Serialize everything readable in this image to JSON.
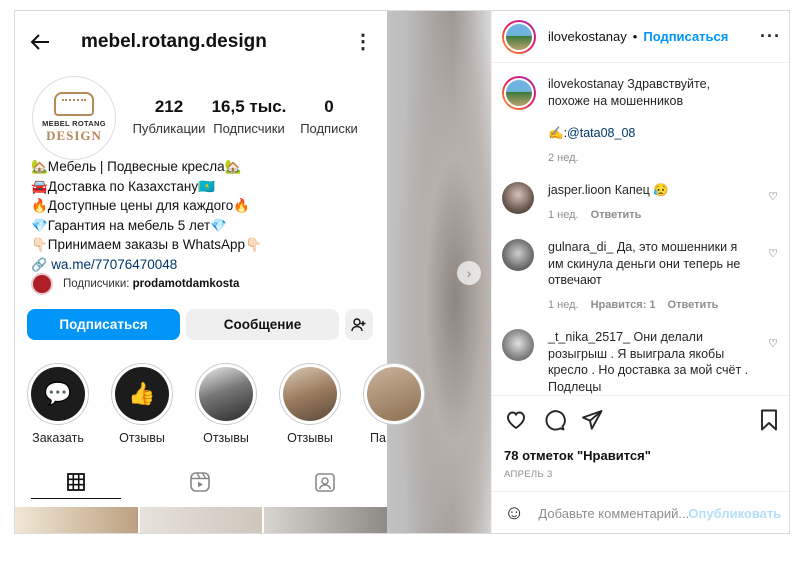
{
  "profile": {
    "username": "mebel.rotang.design",
    "logo_line1": "MEBEL ROTANG",
    "logo_line2": "DESIGN",
    "stats": [
      {
        "value": "212",
        "label": "Публикации"
      },
      {
        "value": "16,5 тыс.",
        "label": "Подписчики"
      },
      {
        "value": "0",
        "label": "Подписки"
      }
    ],
    "bio": [
      "🏡Мебель | Подвесные кресла🏡",
      "🚘Доставка по Казахстану🇰🇿",
      "🔥Доступные цены для каждого🔥",
      "💎Гарантия на мебель 5 лет💎",
      "👇🏻Принимаем заказы в WhatsApp👇🏻"
    ],
    "link": "wa.me/77076470048",
    "followers_prefix": "Подписчики: ",
    "followers_name": "prodamotdamkosta",
    "follow_label": "Подписаться",
    "message_label": "Сообщение",
    "highlights": [
      {
        "label": "Заказать",
        "glyph": "💬"
      },
      {
        "label": "Отзывы",
        "glyph": "👍"
      },
      {
        "label": "Отзывы",
        "glyph": ""
      },
      {
        "label": "Отзывы",
        "glyph": ""
      },
      {
        "label": "Па",
        "glyph": ""
      }
    ]
  },
  "post": {
    "author": "ilovekostanay",
    "dot": "•",
    "follow_label": "Подписаться",
    "caption_user": "ilovekostanay",
    "caption_text": " Здравствуйте, похоже на мошенников",
    "caption_emoji": "✍️:",
    "caption_mention": "@tata08_08",
    "caption_time": "2 нед.",
    "comments": [
      {
        "user": "jasper.lioon",
        "text": " Капец 😥",
        "time": "1 нед.",
        "likes": "",
        "reply": "Ответить"
      },
      {
        "user": "gulnara_di_",
        "text": " Да, это мошенники я им скинула деньги они теперь не отвечают",
        "time": "1 нед.",
        "likes": "Нравится: 1",
        "reply": "Ответить"
      },
      {
        "user": "_t_nika_2517_",
        "text": " Они делали розыгрыш . Я выиграла якобы кресло . Но доставка за мой счёт . Подлецы",
        "time": "",
        "likes": "",
        "reply": ""
      }
    ],
    "likes_text": "78 отметок \"Нравится\"",
    "date": "АПРЕЛЬ 3",
    "comment_placeholder": "Добавьте комментарий...",
    "publish_label": "Опубликовать"
  },
  "colors": {
    "accent": "#0095f6",
    "brand_gold": "#b38a58"
  }
}
